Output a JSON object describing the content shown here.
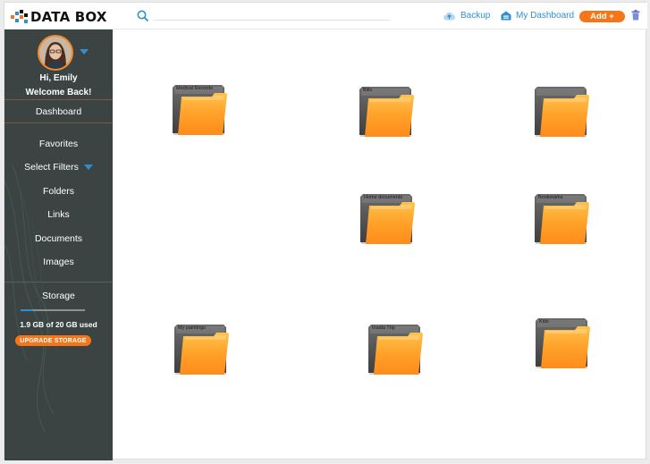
{
  "header": {
    "logo_text": "DATA BOX",
    "backup_label": "Backup",
    "dashboard_label": "My Dashboard",
    "add_label": "Add +"
  },
  "sidebar": {
    "greeting": "Hi, Emily",
    "welcome": "Welcome Back!",
    "items": [
      {
        "label": "Dashboard"
      },
      {
        "label": "Favorites"
      },
      {
        "label": "Select Filters"
      },
      {
        "label": "Folders"
      },
      {
        "label": "Links"
      },
      {
        "label": "Documents"
      },
      {
        "label": "Images"
      }
    ],
    "storage_title": "Storage",
    "storage_used_text": "1.9 GB of 20 GB used",
    "storage_fraction": 0.095,
    "upgrade_label": "UPGRADE STORAGE"
  },
  "folders": [
    {
      "label": "Medical Records"
    },
    {
      "label": "Bills"
    },
    {
      "label": ""
    },
    {
      "label": "Home documents"
    },
    {
      "label": "Bookmarks"
    },
    {
      "label": "My paintings"
    },
    {
      "label": "Inadia Trip"
    },
    {
      "label": "Kids"
    }
  ],
  "colors": {
    "accent_orange": "#f5761a",
    "accent_blue": "#2f8fd5",
    "sidebar_bg": "#3b4443",
    "folder_orange": "#ffa12a",
    "folder_back": "#5b5b5b"
  }
}
